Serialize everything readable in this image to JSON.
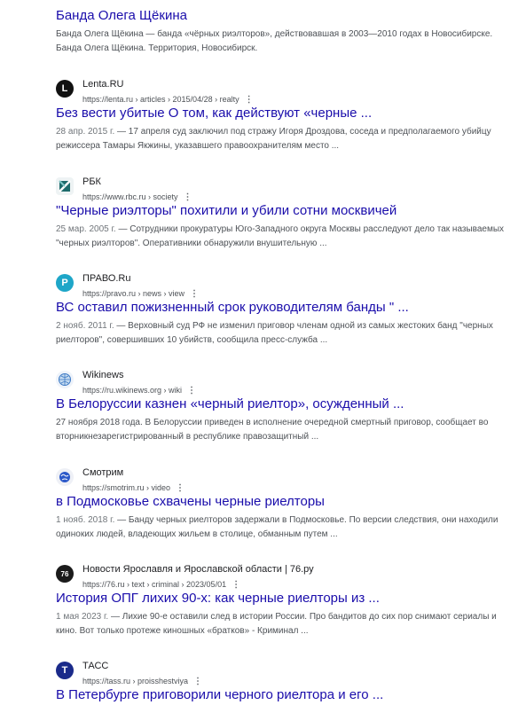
{
  "results": [
    {
      "title": "Банда Олега Щёкина",
      "snippet": "Банда Олега Щёкина — банда «чёрных риэлторов», действовавшая в 2003—2010 годах в Новосибирске. Банда Олега Щёкина. Территория, Новосибирск."
    },
    {
      "site_name": "Lenta.RU",
      "url": "https://lenta.ru › articles › 2015/04/28 › realty",
      "icon": "lenta-logo-icon",
      "title": "Без вести убитые О том, как действуют «черные ...",
      "date": "28 апр. 2015 г.",
      "snippet": " — 17 апреля суд заключил под стражу Игоря Дроздова, соседа и предполагаемого убийцу режиссера Тамары Якжины, указавшего правоохранителям место ..."
    },
    {
      "site_name": "РБК",
      "url": "https://www.rbc.ru › society",
      "icon": "rbc-logo-icon",
      "title": "\"Черные риэлторы\" похитили и убили сотни москвичей",
      "date": "25 мар. 2005 г.",
      "snippet": " — Сотрудники прокуратуры Юго-Западного округа Москвы расследуют дело так называемых \"черных риэлторов\". Оперативники обнаружили внушительную ..."
    },
    {
      "site_name": "ПРАВО.Ru",
      "url": "https://pravo.ru › news › view",
      "icon": "pravo-logo-icon",
      "title": "ВС оставил пожизненный срок руководителям банды \" ...",
      "date": "2 нояб. 2011 г.",
      "snippet": " — Верховный суд РФ не изменил приговор членам одной из самых жестоких банд \"черных риелторов\", совершивших 10 убийств, сообщила пресс-служба ..."
    },
    {
      "site_name": "Wikinews",
      "url": "https://ru.wikinews.org › wiki",
      "icon": "wikinews-logo-icon",
      "title": "В Белоруссии казнен «черный риелтор», осужденный ...",
      "date": "",
      "snippet": "27 ноября 2018 года. В Белоруссии приведен в исполнение очередной смертный приговор, сообщает во вторникнезарегистрированный в республике правозащитный ..."
    },
    {
      "site_name": "Смотрим",
      "url": "https://smotrim.ru › video",
      "icon": "smotrim-logo-icon",
      "title": "в Подмосковье схвачены черные риелторы",
      "date": "1 нояб. 2018 г.",
      "snippet": " — Банду черных риелторов задержали в Подмосковье. По версии следствия, они находили одиноких людей, владеющих жильем в столице, обманным путем ..."
    },
    {
      "site_name": "Новости Ярославля и Ярославской области | 76.ру",
      "url": "https://76.ru › text › criminal › 2023/05/01",
      "icon": "76ru-logo-icon",
      "title": "История ОПГ лихих 90-х: как черные риелторы из ...",
      "date": "1 мая 2023 г.",
      "snippet": " — Лихие 90-е оставили след в истории России. Про бандитов до сих пор снимают сериалы и кино. Вот только протеже киношных «братков» - Криминал ..."
    },
    {
      "site_name": "ТАСС",
      "url": "https://tass.ru › proisshestviya",
      "icon": "tass-logo-icon",
      "title": "В Петербурге приговорили черного риелтора и его ..."
    }
  ],
  "logos": {
    "lenta": "L",
    "rbc": "",
    "pravo": "P",
    "wikinews": "",
    "smotrim": "",
    "r76": "76",
    "tass": "T"
  },
  "kebab": "⋮"
}
